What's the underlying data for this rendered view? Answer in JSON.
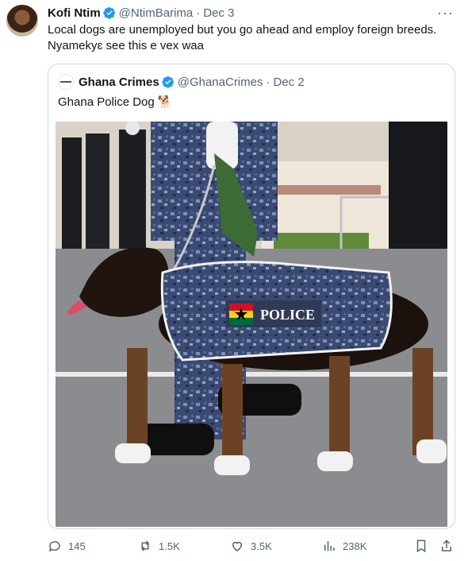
{
  "tweet": {
    "author_name": "Kofi Ntim",
    "handle": "@NtimBarima",
    "separator": "·",
    "date": "Dec 3",
    "more": "···",
    "text": "Local dogs are unemployed but you go ahead and employ foreign breeds. Nyamekyɛ see this e vex waa"
  },
  "quoted": {
    "author_name": "Ghana Crimes",
    "handle": "@GhanaCrimes",
    "separator": "·",
    "date": "Dec 2",
    "text": "Ghana Police Dog 🐕",
    "image": {
      "vest_text": "POLICE"
    }
  },
  "actions": {
    "replies": "145",
    "reposts": "1.5K",
    "likes": "3.5K",
    "views": "238K"
  },
  "colors": {
    "verified": "#1d9bf0",
    "muted": "#536471",
    "border": "#cfd9de"
  }
}
